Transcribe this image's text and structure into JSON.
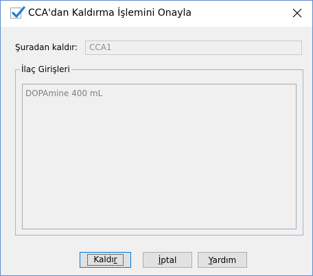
{
  "dialog": {
    "title": "CCA'dan Kaldırma İşlemini Onayla",
    "title_icon": "checkbox-checked-icon",
    "close_icon": "close-icon",
    "accent_color": "#1a7bd6"
  },
  "source": {
    "label": "Şuradan kaldır:",
    "value": "CCA1"
  },
  "drug_group": {
    "legend": "İlaç Girişleri",
    "items": [
      "DOPAmine 400 mL"
    ]
  },
  "buttons": {
    "remove": {
      "pre": "Kaldı",
      "mnemonic": "r",
      "post": ""
    },
    "cancel": {
      "pre": "",
      "mnemonic": "İ",
      "post": "ptal"
    },
    "help": {
      "pre": "",
      "mnemonic": "Y",
      "post": "ardım"
    }
  }
}
